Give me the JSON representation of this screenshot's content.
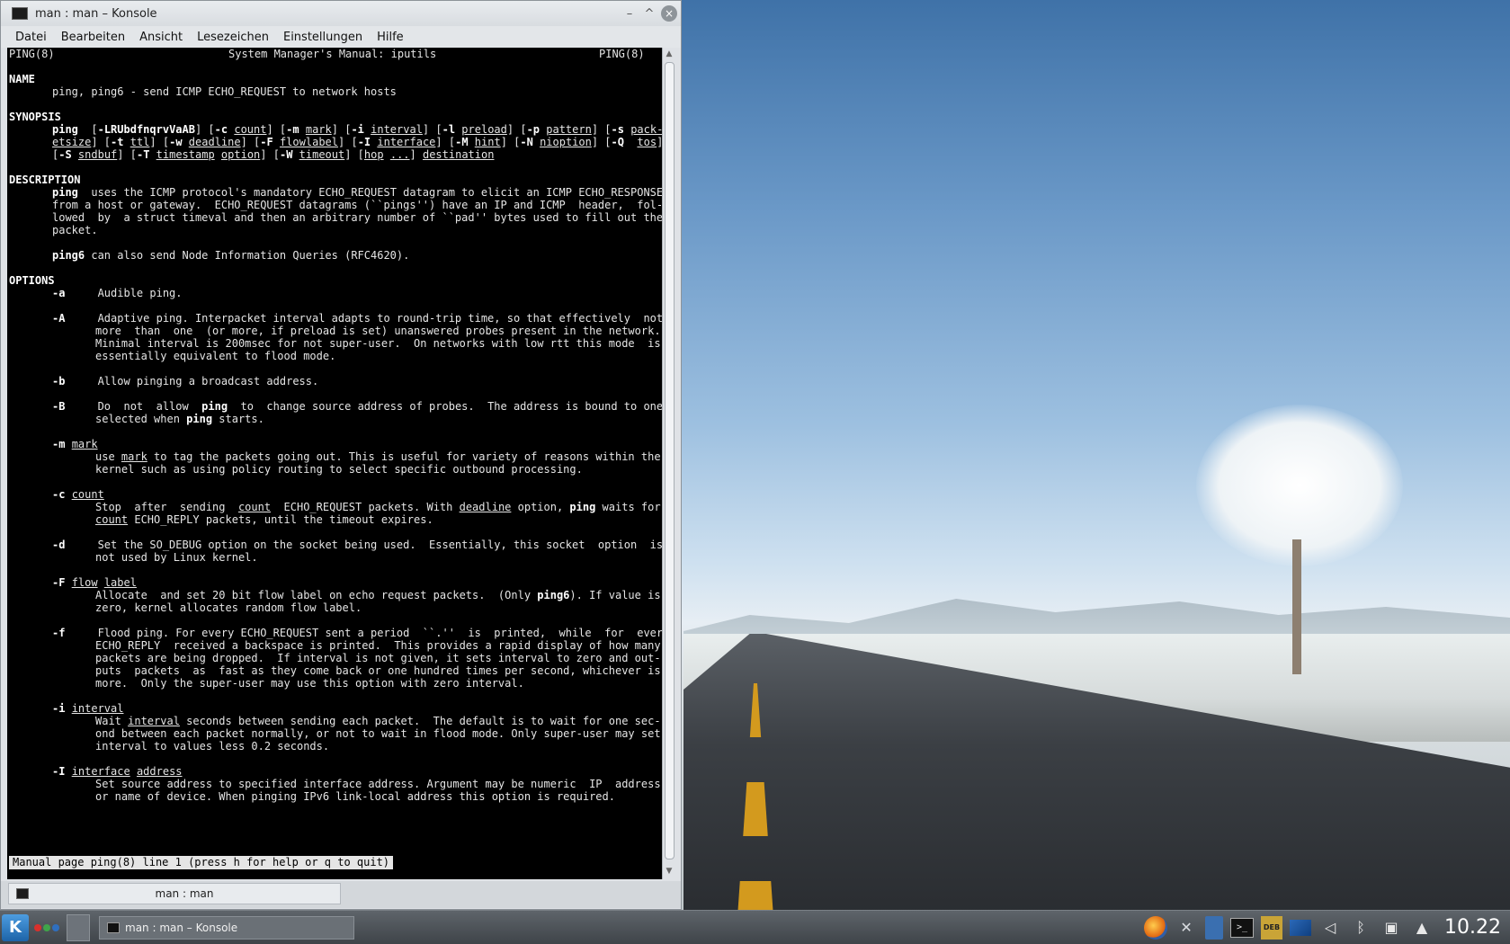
{
  "window": {
    "title": "man : man – Konsole",
    "minimize_glyph": "–",
    "maximize_glyph": "^",
    "close_glyph": "×"
  },
  "menubar": [
    "Datei",
    "Bearbeiten",
    "Ansicht",
    "Lesezeichen",
    "Einstellungen",
    "Hilfe"
  ],
  "manpage": {
    "header_left": "PING(8)",
    "header_center": "System Manager's Manual: iputils",
    "header_right": "PING(8)"
  },
  "status_line": "Manual page ping(8) line 1 (press h for help or q to quit)",
  "tab": {
    "label": "man : man"
  },
  "taskbar": {
    "task_label": "man : man – Konsole",
    "clock": "10.22",
    "deb_label": "DEB",
    "terminal_glyph": ">_"
  },
  "colors": {
    "terminal_bg": "#000000",
    "terminal_fg": "#e5e5e5",
    "status_bg": "#e5e5e5",
    "activity_red": "#d9302c",
    "activity_green": "#3fa54a",
    "activity_blue": "#2f6fbf"
  },
  "icons": {
    "launcher": "kde-icon",
    "app": "konsole-icon",
    "tray": [
      "firefox-icon",
      "tools-icon",
      "files-icon",
      "terminal-icon",
      "deb-icon",
      "monitor-icon",
      "volume-icon",
      "bluetooth-icon",
      "network-icon",
      "expand-icon"
    ]
  }
}
